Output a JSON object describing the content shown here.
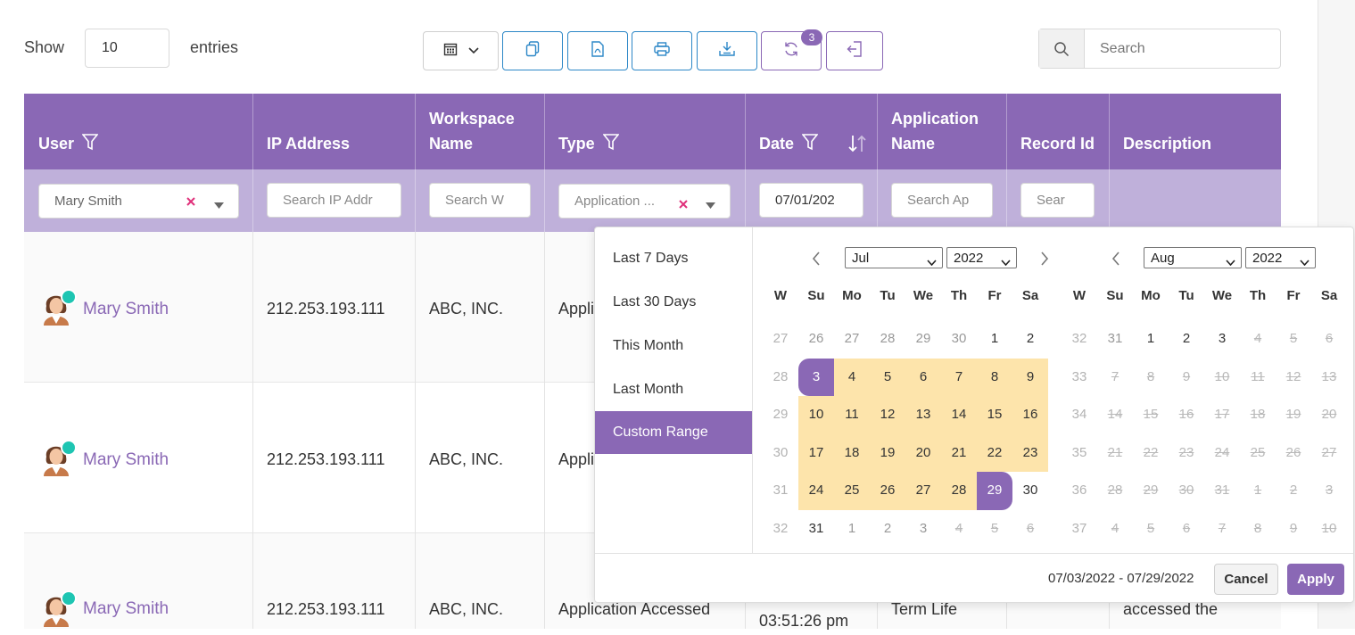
{
  "controls": {
    "show_label": "Show",
    "entries_value": "10",
    "entries_label": "entries",
    "refresh_badge": "3",
    "search_placeholder": "Search"
  },
  "table": {
    "headers": {
      "user": "User",
      "ip": "IP Address",
      "workspace": "Workspace Name",
      "type": "Type",
      "date": "Date",
      "application": "Application Name",
      "record": "Record Id",
      "description": "Description"
    },
    "filters": {
      "user": "Mary Smith",
      "ip_placeholder": "Search IP Addr",
      "workspace_placeholder": "Search W",
      "type": "Application ...",
      "date": "07/01/202",
      "application_placeholder": "Search Ap",
      "record_placeholder": "Sear"
    },
    "rows": [
      {
        "user": "Mary Smith",
        "ip": "212.253.193.111",
        "workspace": "ABC, INC.",
        "type": "Appli"
      },
      {
        "user": "Mary Smith",
        "ip": "212.253.193.111",
        "workspace": "ABC, INC.",
        "type": "Appli"
      },
      {
        "user": "Mary Smith",
        "ip": "212.253.193.111",
        "workspace": "ABC, INC.",
        "type": "Application Accessed",
        "time": "03:51:26 pm",
        "application": "Term Life",
        "description": "accessed the"
      }
    ]
  },
  "picker": {
    "ranges": [
      "Last 7 Days",
      "Last 30 Days",
      "This Month",
      "Last Month",
      "Custom Range"
    ],
    "left": {
      "month": "Jul",
      "year": "2022"
    },
    "right": {
      "month": "Aug",
      "year": "2022"
    },
    "week_label": "W",
    "days_of_week": [
      "Su",
      "Mo",
      "Tu",
      "We",
      "Th",
      "Fr",
      "Sa"
    ],
    "left_weeks": [
      {
        "w": "27",
        "days": [
          "26",
          "27",
          "28",
          "29",
          "30",
          "1",
          "2"
        ]
      },
      {
        "w": "28",
        "days": [
          "3",
          "4",
          "5",
          "6",
          "7",
          "8",
          "9"
        ]
      },
      {
        "w": "29",
        "days": [
          "10",
          "11",
          "12",
          "13",
          "14",
          "15",
          "16"
        ]
      },
      {
        "w": "30",
        "days": [
          "17",
          "18",
          "19",
          "20",
          "21",
          "22",
          "23"
        ]
      },
      {
        "w": "31",
        "days": [
          "24",
          "25",
          "26",
          "27",
          "28",
          "29",
          "30"
        ]
      },
      {
        "w": "32",
        "days": [
          "31",
          "1",
          "2",
          "3",
          "4",
          "5",
          "6"
        ]
      }
    ],
    "right_weeks": [
      {
        "w": "32",
        "days": [
          "31",
          "1",
          "2",
          "3",
          "4",
          "5",
          "6"
        ]
      },
      {
        "w": "33",
        "days": [
          "7",
          "8",
          "9",
          "10",
          "11",
          "12",
          "13"
        ]
      },
      {
        "w": "34",
        "days": [
          "14",
          "15",
          "16",
          "17",
          "18",
          "19",
          "20"
        ]
      },
      {
        "w": "35",
        "days": [
          "21",
          "22",
          "23",
          "24",
          "25",
          "26",
          "27"
        ]
      },
      {
        "w": "36",
        "days": [
          "28",
          "29",
          "30",
          "31",
          "1",
          "2",
          "3"
        ]
      },
      {
        "w": "37",
        "days": [
          "4",
          "5",
          "6",
          "7",
          "8",
          "9",
          "10"
        ]
      }
    ],
    "selected_range": "07/03/2022 - 07/29/2022",
    "cancel_label": "Cancel",
    "apply_label": "Apply",
    "colors": {
      "accent": "#8a68b5",
      "range": "#fde4ab"
    }
  }
}
